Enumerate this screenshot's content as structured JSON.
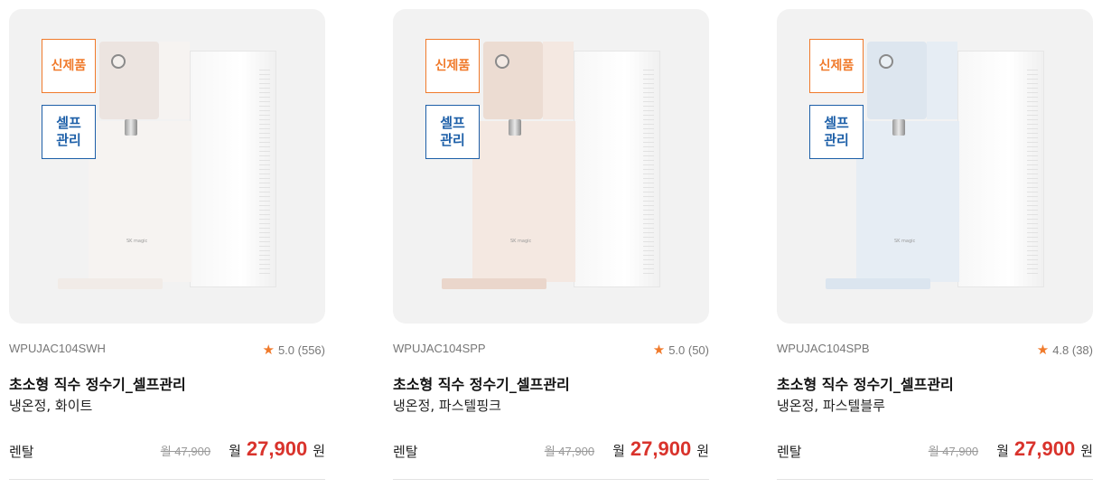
{
  "products": [
    {
      "badge_new": "신제품",
      "badge_self": "셀프\n관리",
      "model": "WPUJAC104SWH",
      "rating": "5.0 (556)",
      "title": "초소형 직수 정수기_셀프관리",
      "subtitle": "냉온정, 화이트",
      "rent_label": "렌탈",
      "original_price": "월 47,900",
      "month_label": "월",
      "price": "27,900",
      "currency": "원",
      "front_color": "#f6f3f1",
      "head_color": "#ece4e0",
      "tray_color": "#f1ebe7"
    },
    {
      "badge_new": "신제품",
      "badge_self": "셀프\n관리",
      "model": "WPUJAC104SPP",
      "rating": "5.0 (50)",
      "title": "초소형 직수 정수기_셀프관리",
      "subtitle": "냉온정, 파스텔핑크",
      "rent_label": "렌탈",
      "original_price": "월 47,900",
      "month_label": "월",
      "price": "27,900",
      "currency": "원",
      "front_color": "#f4e8e1",
      "head_color": "#ecdcd2",
      "tray_color": "#ead6cb"
    },
    {
      "badge_new": "신제품",
      "badge_self": "셀프\n관리",
      "model": "WPUJAC104SPB",
      "rating": "4.8 (38)",
      "title": "초소형 직수 정수기_셀프관리",
      "subtitle": "냉온정, 파스텔블루",
      "rent_label": "렌탈",
      "original_price": "월 47,900",
      "month_label": "월",
      "price": "27,900",
      "currency": "원",
      "front_color": "#e6edf4",
      "head_color": "#dde6ef",
      "tray_color": "#dbe5ef"
    }
  ],
  "icons": {
    "rating": "star-icon"
  }
}
